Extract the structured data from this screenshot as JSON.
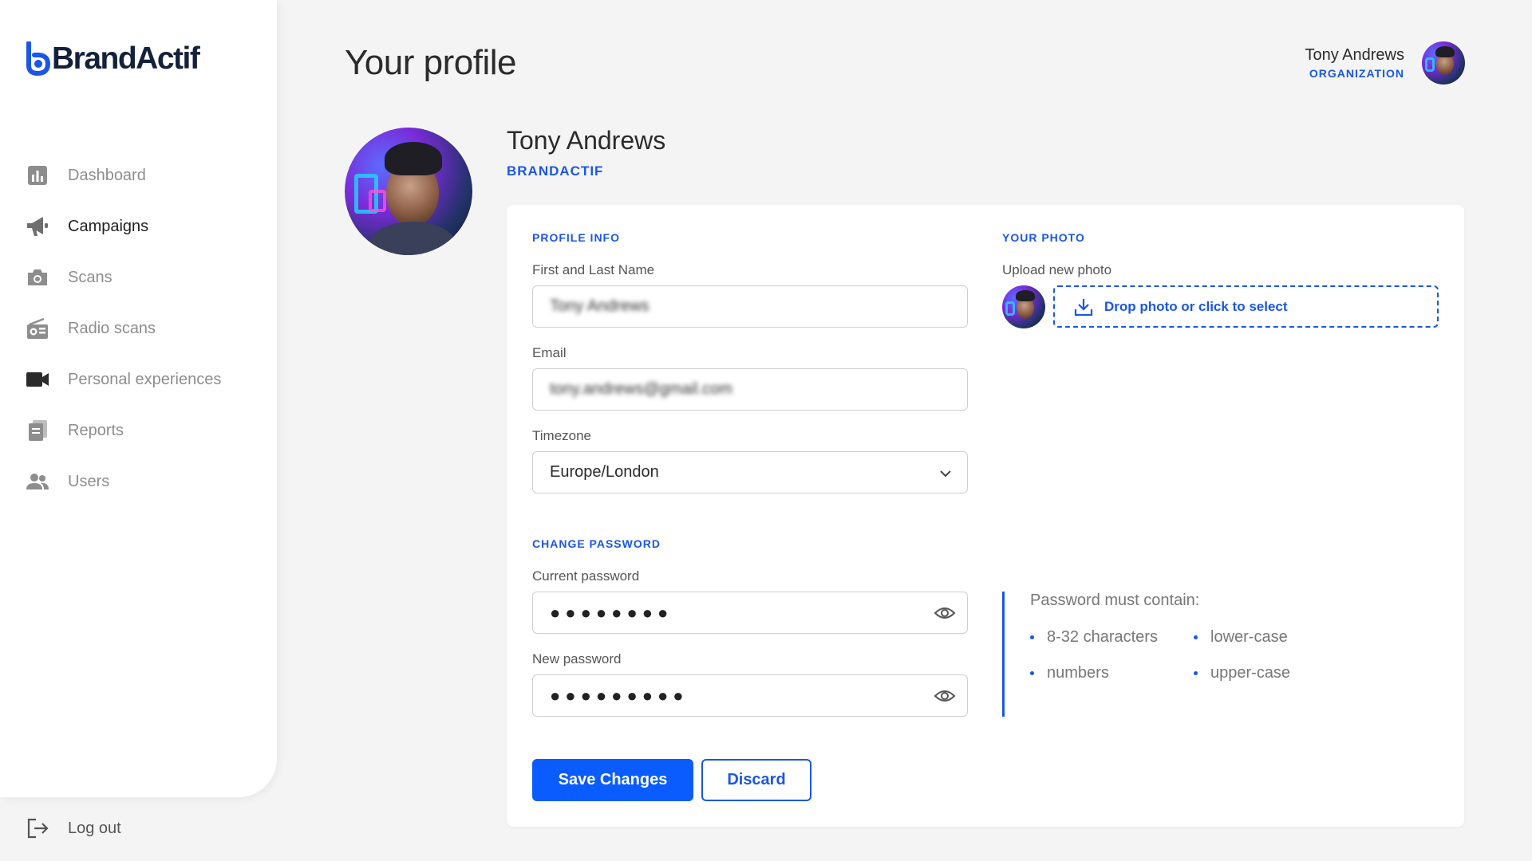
{
  "app": {
    "logo_text": "BrandActif"
  },
  "sidebar": {
    "items": [
      {
        "label": "Dashboard",
        "icon": "bar-chart-icon",
        "active": false
      },
      {
        "label": "Campaigns",
        "icon": "megaphone-icon",
        "active": true
      },
      {
        "label": "Scans",
        "icon": "camera-icon",
        "active": false
      },
      {
        "label": "Radio scans",
        "icon": "radio-icon",
        "active": false
      },
      {
        "label": "Personal experiences",
        "icon": "video-camera-icon",
        "active": false
      },
      {
        "label": "Reports",
        "icon": "documents-icon",
        "active": false
      },
      {
        "label": "Users",
        "icon": "users-icon",
        "active": false
      }
    ],
    "logout_label": "Log out"
  },
  "header": {
    "title": "Your profile",
    "user_name": "Tony Andrews",
    "user_role": "ORGANIZATION"
  },
  "profile": {
    "name": "Tony Andrews",
    "organization": "BRANDACTIF"
  },
  "form": {
    "profile_info_label": "PROFILE INFO",
    "name_label": "First and Last Name",
    "name_value": "Tony Andrews",
    "email_label": "Email",
    "email_value": "tony.andrews@gmail.com",
    "timezone_label": "Timezone",
    "timezone_value": "Europe/London",
    "change_password_label": "CHANGE PASSWORD",
    "current_password_label": "Current password",
    "current_password_mask": "●●●●●●●●",
    "new_password_label": "New password",
    "new_password_mask": "●●●●●●●●●",
    "photo_label": "YOUR PHOTO",
    "upload_label": "Upload new photo",
    "dropzone_text": "Drop photo or click to select",
    "rules_title": "Password must contain:",
    "rules": [
      "8-32 characters",
      "lower-case",
      "numbers",
      "upper-case"
    ],
    "save_label": "Save Changes",
    "discard_label": "Discard"
  },
  "colors": {
    "accent": "#1a56e8",
    "primary_button": "#0b5cff",
    "background": "#f4f4f4"
  }
}
